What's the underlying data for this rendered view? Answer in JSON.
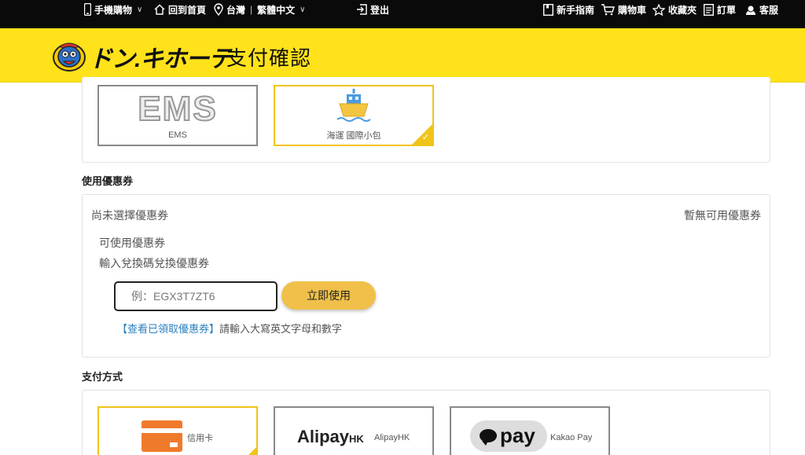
{
  "topbar": {
    "mobile_label": "手機購物",
    "home_label": "回到首頁",
    "region_label": "台灣",
    "lang_label": "繁體中文",
    "logout_label": "登出",
    "guide_label": "新手指南",
    "cart_label": "購物車",
    "favorites_label": "收藏夾",
    "orders_label": "訂單",
    "service_label": "客服"
  },
  "header": {
    "brand": "ドン.キホーテ",
    "title": "支付確認"
  },
  "shipping": {
    "options": [
      {
        "logo_text": "EMS",
        "label": "EMS",
        "selected": false
      },
      {
        "label": "海運 國際小包",
        "selected": true
      }
    ]
  },
  "coupon": {
    "section_label": "使用優惠券",
    "status": "尚未選擇優惠券",
    "none_available": "暫無可用優惠券",
    "available_label": "可使用優惠券",
    "redeem_label": "輸入兌換碼兌換優惠券",
    "input_placeholder": "例：EGX3T7ZT6",
    "use_button": "立即使用",
    "view_link": "【查看已領取優惠券】",
    "hint": "請輸入大寫英文字母和數字"
  },
  "payment": {
    "section_label": "支付方式",
    "options": [
      {
        "label": "信用卡",
        "selected": true
      },
      {
        "brand": "Alipay",
        "brand_suffix": "HK",
        "label": "AlipayHK",
        "selected": false
      },
      {
        "brand": "pay",
        "label": "Kakao Pay",
        "selected": false
      }
    ]
  },
  "colors": {
    "header_yellow": "#ffe21a",
    "selected_border": "#f0c419",
    "button": "#f0c04a",
    "link": "#2a7fbf",
    "card_orange": "#f07a2c"
  }
}
